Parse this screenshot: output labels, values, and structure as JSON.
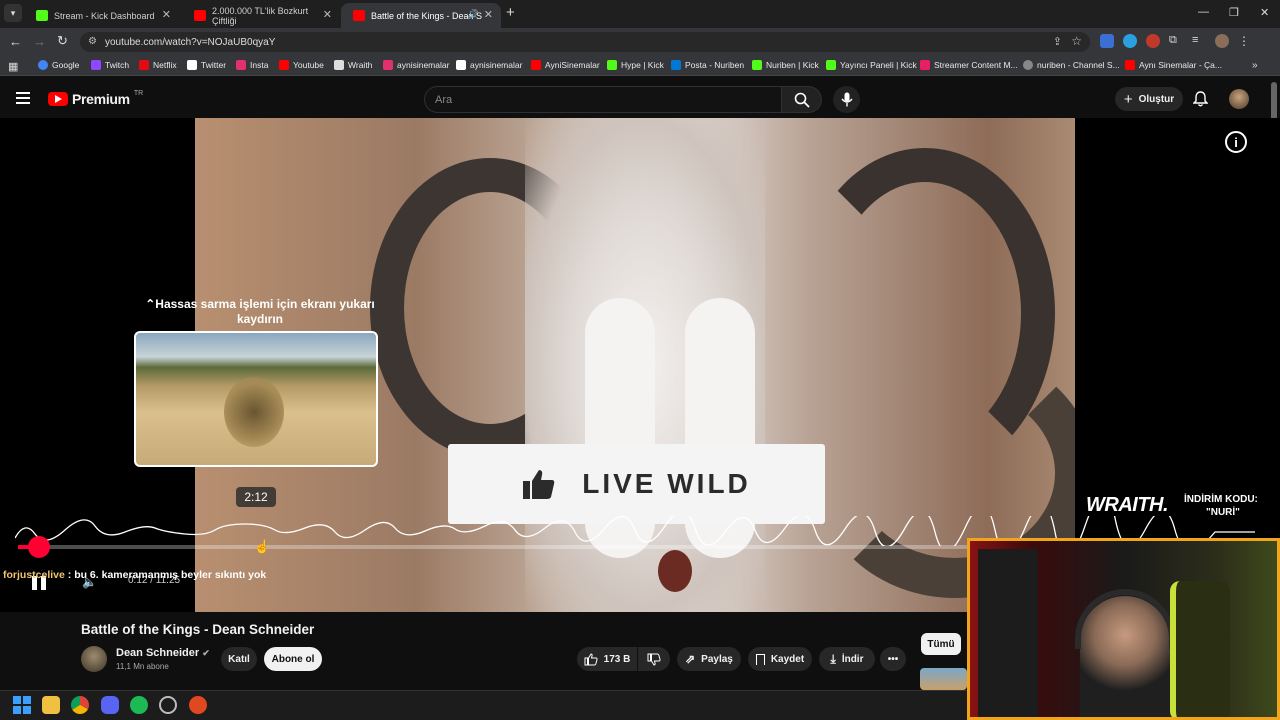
{
  "browser": {
    "tabs": [
      {
        "title": "Stream - Kick Dashboard",
        "favicon_color": "#53fc18"
      },
      {
        "title": "2.000.000 TL'lik Bozkurt Çiftliği",
        "favicon_color": "#ff0000"
      },
      {
        "title": "Battle of the Kings - Dean S",
        "favicon_color": "#ff0000"
      }
    ],
    "url": "youtube.com/watch?v=NOJaUB0qyaY",
    "bookmarks": [
      {
        "label": "Google",
        "color": "#4285f4"
      },
      {
        "label": "Twitch",
        "color": "#9146ff"
      },
      {
        "label": "Netflix",
        "color": "#e50914"
      },
      {
        "label": "Twitter",
        "color": "#ffffff"
      },
      {
        "label": "Insta",
        "color": "#e1306c"
      },
      {
        "label": "Youtube",
        "color": "#ff0000"
      },
      {
        "label": "Wraith",
        "color": "#dddddd"
      },
      {
        "label": "aynisinemalar",
        "color": "#e1306c"
      },
      {
        "label": "aynisinemalar",
        "color": "#ffffff"
      },
      {
        "label": "AyniSinemalar",
        "color": "#ff0000"
      },
      {
        "label": "Hype | Kick",
        "color": "#53fc18"
      },
      {
        "label": "Posta - Nuriben",
        "color": "#0078d4"
      },
      {
        "label": "Nuriben | Kick",
        "color": "#53fc18"
      },
      {
        "label": "Yayıncı Paneli | Kick",
        "color": "#53fc18"
      },
      {
        "label": "Streamer Content M...",
        "color": "#e91e63"
      },
      {
        "label": "nuriben - Channel S...",
        "color": "#888888"
      },
      {
        "label": "Aynı Sinemalar - Ça...",
        "color": "#ff0000"
      }
    ]
  },
  "youtube": {
    "logo_text": "Premium",
    "logo_region": "TR",
    "search_placeholder": "Ara",
    "create_label": "Oluştur"
  },
  "player": {
    "scrub_hint": "Hassas sarma işlemi için ekranı yukarı kaydırın",
    "preview_time": "2:12",
    "time_text": "0:12 / 11:25",
    "progress": 0.017,
    "overlay_text": "LIVE WILD",
    "sponsor_brand": "WRAITH.",
    "sponsor_code_label": "İNDİRİM KODU:",
    "sponsor_code": "\"NURİ\"",
    "chat_user": "forjustcelive",
    "chat_message": " : bu 6. kameramanmış beyler sıkıntı yok"
  },
  "video": {
    "title": "Battle of the Kings - Dean Schneider",
    "channel": "Dean Schneider",
    "subscribers": "11,1 Mn abone",
    "join_label": "Katıl",
    "subscribe_label": "Abone ol",
    "likes": "173 B",
    "share_label": "Paylaş",
    "save_label": "Kaydet",
    "download_label": "İndir",
    "filter_all": "Tümü"
  }
}
